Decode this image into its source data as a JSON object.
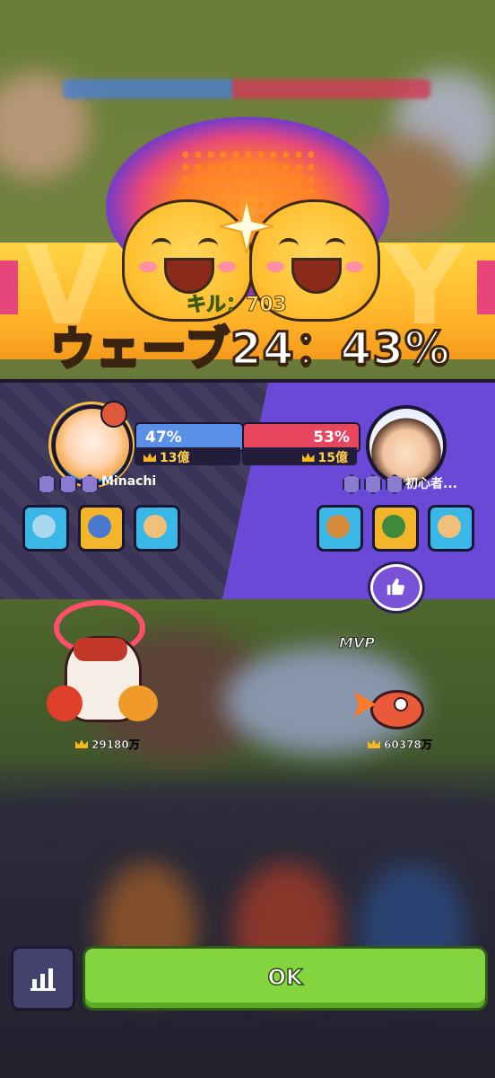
{
  "result": {
    "kill_label": "キル",
    "kill_value": "703",
    "wave_text": "ウェーブ24：43%"
  },
  "player_left": {
    "name": "Minachi",
    "percent": "47%",
    "power": "13億"
  },
  "player_right": {
    "name": "初心者...",
    "percent": "53%",
    "power": "15億"
  },
  "battlefield": {
    "left_power": "29180万",
    "right_power": "60378万",
    "mvp_label": "MVP"
  },
  "buttons": {
    "ok_label": "OK"
  },
  "icons": {
    "stats": "bar-chart-icon",
    "like": "thumbs-up-icon"
  },
  "colors": {
    "left_team": "#5a8fe8",
    "right_team": "#e8465f",
    "ok_button": "#84d43f",
    "right_panel": "#6a49d6",
    "left_panel": "#3a3458"
  }
}
